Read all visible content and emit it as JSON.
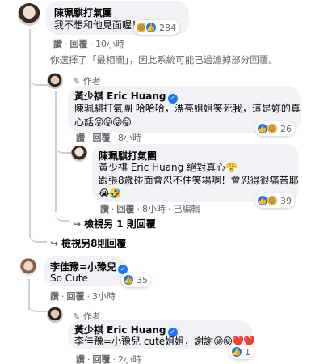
{
  "c1": {
    "name": "陳珮騏打氣團",
    "text": "我不想和他見面喔！",
    "emoji": "🤣",
    "react_count": "284",
    "like": "讚",
    "reply": "回覆",
    "time": "10小時"
  },
  "filter_notice": "你選擇了「最相關」，因此系統可能已過濾掉部分回覆。",
  "r1": {
    "author_label": "作者",
    "name": "黃少祺 Eric Huang",
    "text_line1": "陳珮騏打氣團 哈哈哈，漂亮姐姐笑死我，這是妳的真",
    "text_line2": "心話",
    "emoji": "😝😝😝😝",
    "react_count": "26",
    "like": "讚",
    "reply": "回覆",
    "time": "8小時"
  },
  "r2": {
    "name": "陳珮騏打氣團",
    "text_line1": "黃少祺 Eric Huang 絕對真心",
    "emoji1": "😤",
    "text_line2": "跟張8歲碰面會忍不住笑場啊！會忍得很痛苦耶",
    "emoji2": "😭🤣",
    "react_count": "39",
    "like": "讚",
    "reply": "回覆",
    "time": "8小時",
    "edited": "已編輯"
  },
  "more_replies_1": "檢視另 1 則回覆",
  "more_replies_8": "檢視另8則回覆",
  "c2": {
    "name": "李佳豫=小豫兒",
    "text": "So Cute",
    "react_count": "35",
    "like": "讚",
    "reply": "回覆",
    "time": "3小時"
  },
  "r3": {
    "author_label": "作者",
    "name": "黃少祺 Eric Huang",
    "text": "李佳豫=小豫兒 cute姐姐，謝謝",
    "emoji": "😝😝❤️❤️",
    "react_count": "1",
    "like": "讚",
    "reply": "回覆",
    "time": "2小時"
  },
  "icons": [
    "verified-icon",
    "pencil-icon",
    "reply-arrow-icon",
    "haha-reaction-icon",
    "like-reaction-icon",
    "heart-reaction-icon"
  ],
  "colors": {
    "link": "#1877f2",
    "secondary": "#65676b",
    "bubble": "#f0f2f5",
    "thread_line": "#ced0d4"
  }
}
